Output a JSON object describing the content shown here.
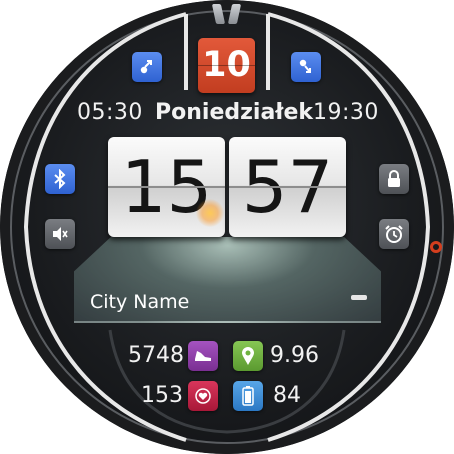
{
  "date": {
    "day": "10"
  },
  "sun": {
    "sunrise": "05:30",
    "sunset": "19:30"
  },
  "day_name": "Poniedziałek",
  "clock": {
    "hours": "15",
    "minutes": "57"
  },
  "weather": {
    "city": "City Name"
  },
  "stats": {
    "steps": "5748",
    "distance": "9.96",
    "heart_rate": "153",
    "battery": "84"
  },
  "colors": {
    "date_box": "#d6492b",
    "blue_icon": "#3f73e0",
    "grey_icon": "#5f6267",
    "steps_icon": "#8b3fa0",
    "location_icon": "#6fb240",
    "heart_icon": "#c8244a",
    "battery_icon": "#3b8fd8",
    "accent": "#d43e1e"
  },
  "icons": {
    "sunrise": "sunrise-arrow-icon",
    "sunset": "sunset-arrow-icon",
    "bluetooth": "bluetooth-icon",
    "sound": "speaker-mute-icon",
    "lock": "lock-icon",
    "alarm": "alarm-clock-icon",
    "steps": "sneaker-icon",
    "distance": "location-pin-icon",
    "heart": "heart-icon",
    "battery": "battery-icon",
    "weather_menu": "minus-icon"
  }
}
